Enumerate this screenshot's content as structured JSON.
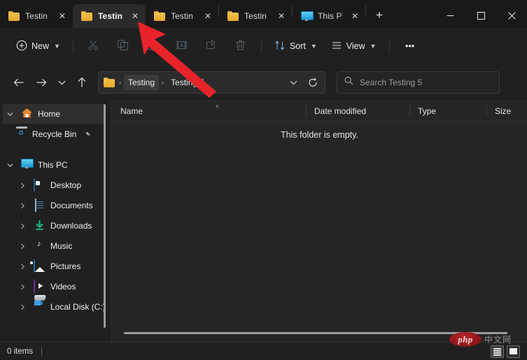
{
  "window": {
    "controls": {
      "minimize": "minimize-button",
      "maximize": "maximize-button",
      "close": "close-button"
    }
  },
  "tabs": {
    "items": [
      {
        "label": "Testin",
        "icon": "folder-icon",
        "active": false
      },
      {
        "label": "Testin",
        "icon": "folder-icon",
        "active": true
      },
      {
        "label": "Testin",
        "icon": "folder-icon",
        "active": false
      },
      {
        "label": "Testin",
        "icon": "folder-icon",
        "active": false
      },
      {
        "label": "This P",
        "icon": "monitor-icon",
        "active": false
      }
    ],
    "close_glyph": "✕",
    "new_tab_label": "+"
  },
  "toolbar": {
    "new_label": "New",
    "new_icon": "plus-circle-icon",
    "cut_icon": "scissors-icon",
    "copy_icon": "copy-icon",
    "paste_icon": "paste-icon",
    "rename_icon": "rename-icon",
    "share_icon": "share-icon",
    "delete_icon": "trash-icon",
    "sort_label": "Sort",
    "sort_icon": "sort-arrows-icon",
    "view_label": "View",
    "view_icon": "list-lines-icon",
    "more_label": "•••"
  },
  "address": {
    "back_icon": "arrow-left-icon",
    "forward_icon": "arrow-right-icon",
    "recent_icon": "chevron-down-icon",
    "up_icon": "arrow-up-icon",
    "folder_icon": "folder-icon",
    "separator": "›",
    "crumbs": [
      {
        "label": "Testing",
        "highlighted": true
      },
      {
        "label": "Testing 5",
        "highlighted": false
      }
    ],
    "dropdown_icon": "chevron-down-icon",
    "refresh_icon": "refresh-icon"
  },
  "search": {
    "icon": "search-icon",
    "placeholder": "Search Testing 5",
    "value": ""
  },
  "sidebar": {
    "items": [
      {
        "label": "Home",
        "icon": "home-icon",
        "expander": "chevron-down",
        "selected": true,
        "indent": false,
        "pinned": false
      },
      {
        "label": "Recycle Bin",
        "icon": "recycle-bin-icon",
        "expander": "none",
        "selected": false,
        "indent": true,
        "pinned": true
      },
      {
        "label": "This PC",
        "icon": "monitor-icon",
        "expander": "chevron-down",
        "selected": false,
        "indent": false,
        "pinned": false
      },
      {
        "label": "Desktop",
        "icon": "desktop-icon",
        "expander": "chevron-right",
        "selected": false,
        "indent": true,
        "pinned": false
      },
      {
        "label": "Documents",
        "icon": "documents-icon",
        "expander": "chevron-right",
        "selected": false,
        "indent": true,
        "pinned": false
      },
      {
        "label": "Downloads",
        "icon": "downloads-icon",
        "expander": "chevron-right",
        "selected": false,
        "indent": true,
        "pinned": false
      },
      {
        "label": "Music",
        "icon": "music-icon",
        "expander": "chevron-right",
        "selected": false,
        "indent": true,
        "pinned": false
      },
      {
        "label": "Pictures",
        "icon": "pictures-icon",
        "expander": "chevron-right",
        "selected": false,
        "indent": true,
        "pinned": false
      },
      {
        "label": "Videos",
        "icon": "videos-icon",
        "expander": "chevron-right",
        "selected": false,
        "indent": true,
        "pinned": false
      },
      {
        "label": "Local Disk (C:)",
        "icon": "disk-icon",
        "expander": "chevron-right",
        "selected": false,
        "indent": true,
        "pinned": false
      }
    ],
    "pin_glyph": "✒"
  },
  "file_pane": {
    "columns": [
      {
        "label": "Name",
        "sort_caret": "˄"
      },
      {
        "label": "Date modified",
        "sort_caret": ""
      },
      {
        "label": "Type",
        "sort_caret": ""
      },
      {
        "label": "Size",
        "sort_caret": ""
      }
    ],
    "empty_message": "This folder is empty."
  },
  "status_bar": {
    "item_count": "0 items",
    "details_view_icon": "details-view-icon",
    "large_icons_view_icon": "large-icons-view-icon"
  },
  "watermark": {
    "logo_text": "php",
    "site_text": "中文网"
  },
  "annotation": {
    "type": "red-arrow",
    "color": "#e8232a",
    "points_to": "tab-close-button-active-tab"
  }
}
